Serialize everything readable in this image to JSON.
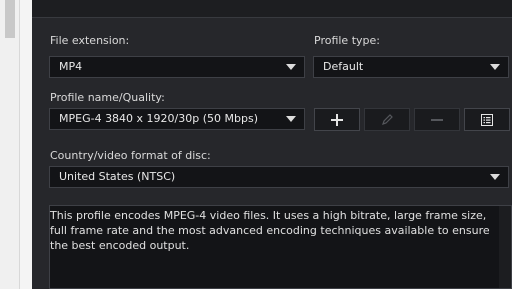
{
  "file_extension": {
    "label": "File extension:",
    "value": "MP4"
  },
  "profile_type": {
    "label": "Profile type:",
    "value": "Default"
  },
  "profile_name": {
    "label": "Profile name/Quality:",
    "value": "MPEG-4 3840 x 1920/30p (50 Mbps)"
  },
  "country_format": {
    "label": "Country/video format of disc:",
    "value": "United States (NTSC)"
  },
  "description": "This profile encodes MPEG-4 video files. It uses a high bitrate, large frame size, full frame rate and the most advanced encoding techniques available to ensure the best encoded output.",
  "icons": [
    "plus-icon",
    "pencil-icon",
    "minus-icon",
    "list-details-icon"
  ]
}
